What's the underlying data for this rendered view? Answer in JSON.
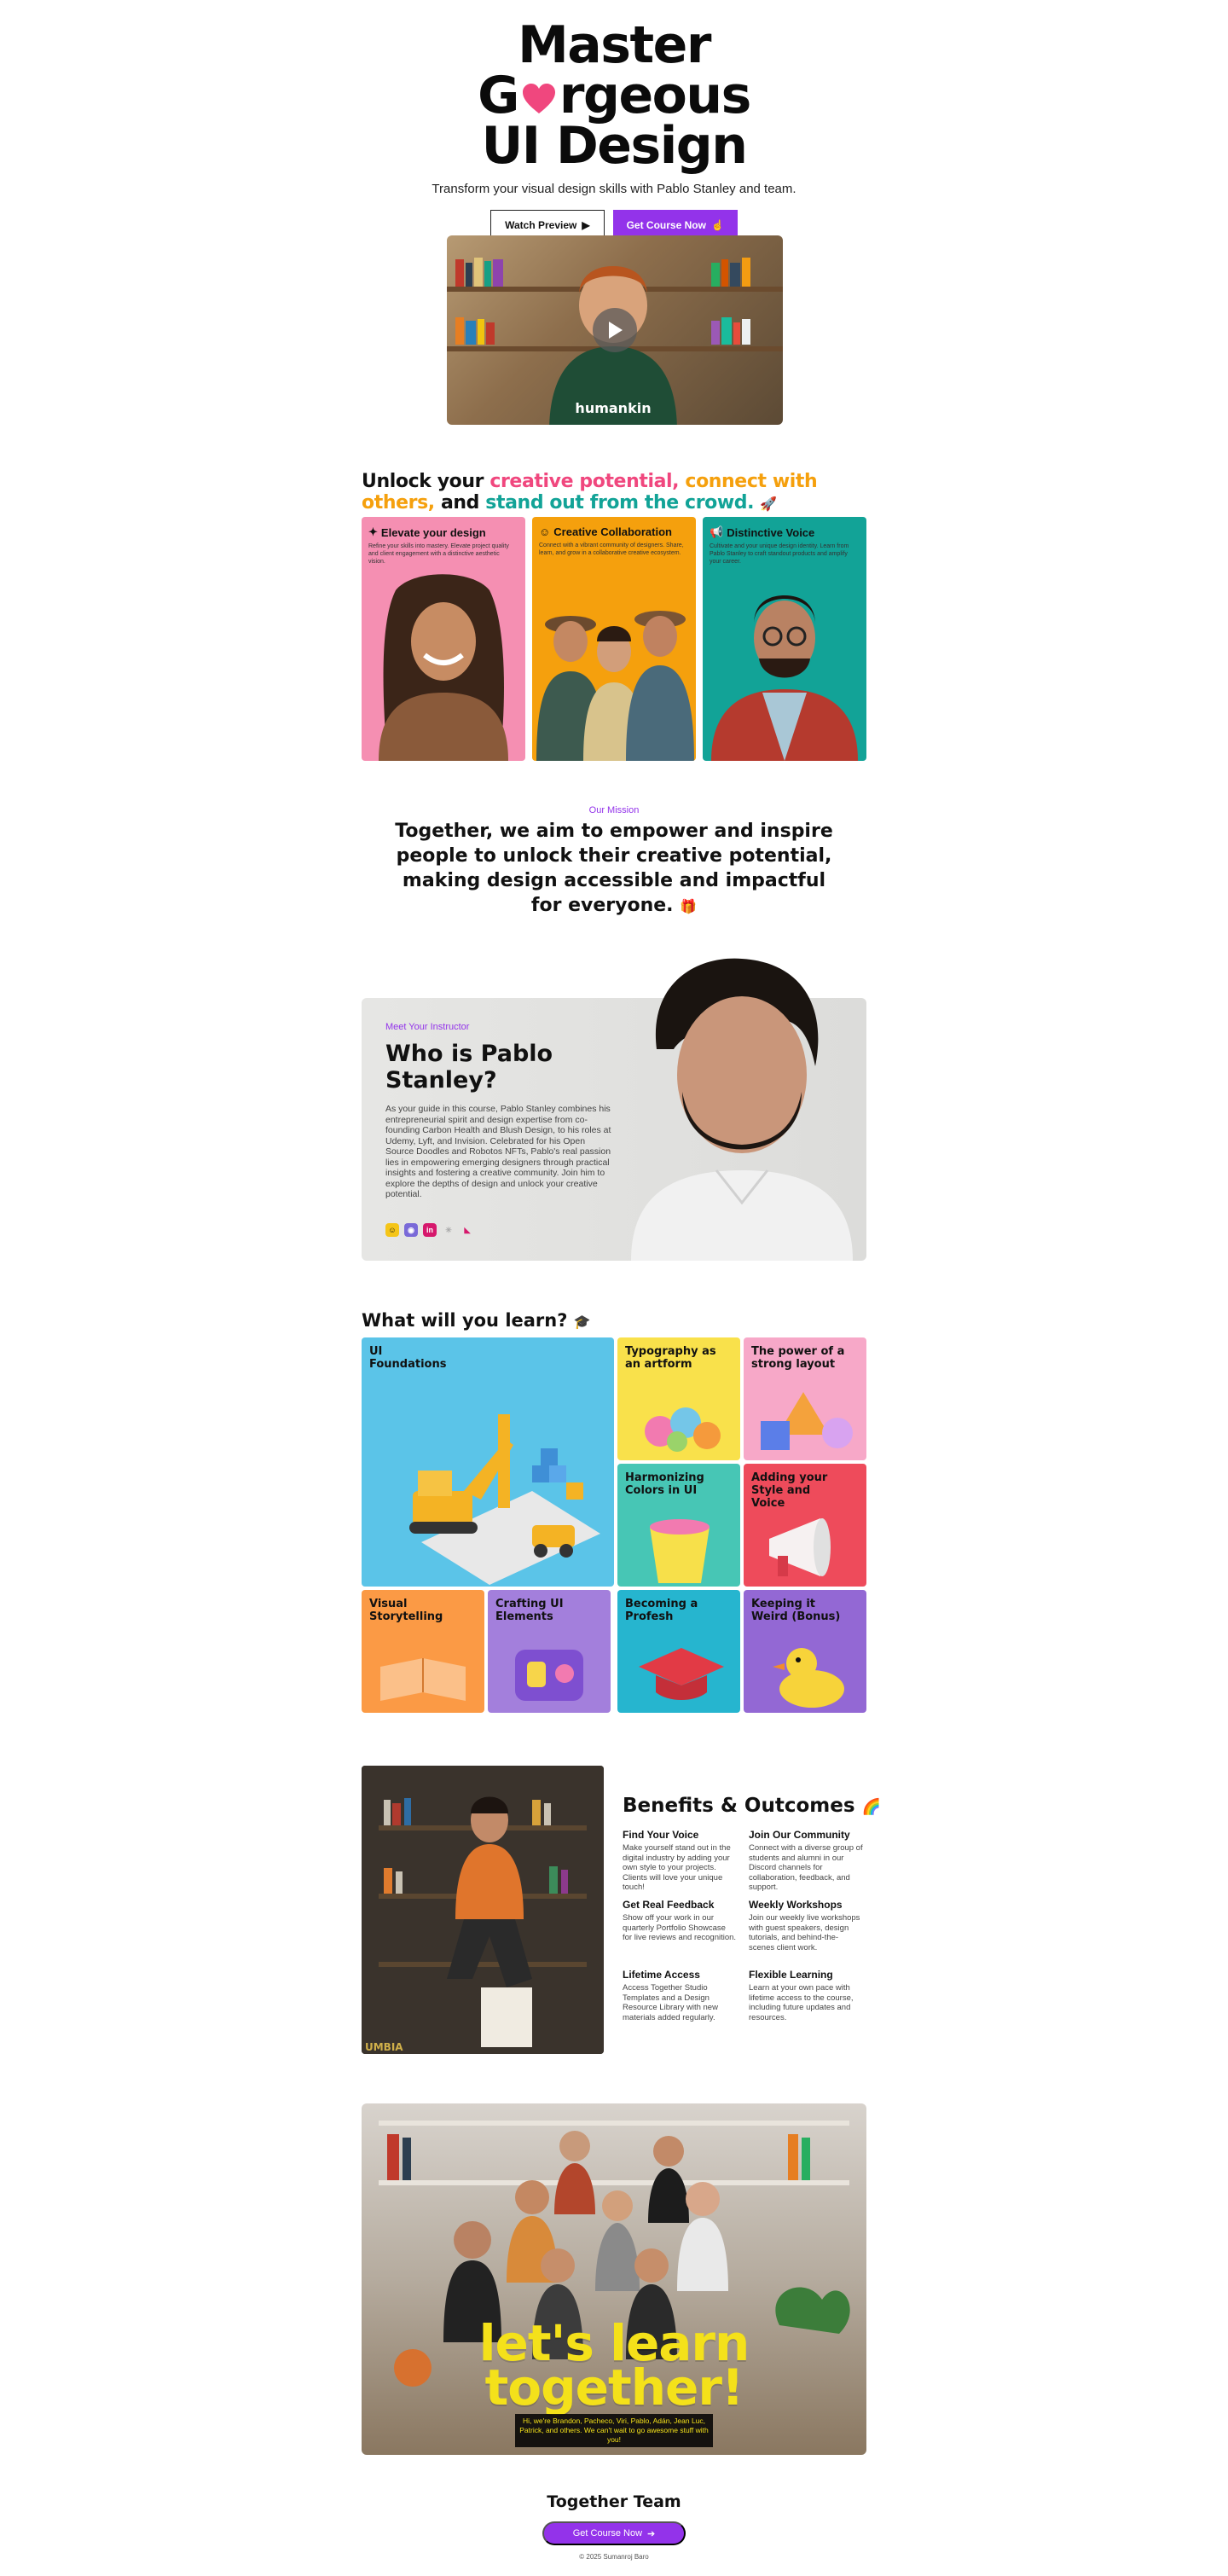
{
  "hero": {
    "title_line1": "Master",
    "title_line2_a": "G",
    "title_line2_b": "rgeous",
    "title_line3": "UI Design",
    "subtitle": "Transform your visual design skills with Pablo Stanley and team.",
    "watch_label": "Watch Preview",
    "cta_label": "Get Course Now",
    "heart_color": "#f0477e",
    "accent": "#9333ea"
  },
  "unlock": {
    "p1": "Unlock your ",
    "p2": "creative potential,",
    "p3": " ",
    "p4": "connect with others,",
    "p5": " and ",
    "p6": "stand out from the crowd.",
    "cards": [
      {
        "title": "Elevate your design",
        "icon": "sparkle-icon",
        "text": "Refine your skills into mastery. Elevate project quality and client engagement with a distinctive aesthetic vision.",
        "color": "#f58fb2"
      },
      {
        "title": "Creative Collaboration",
        "icon": "people-icon",
        "text": "Connect with a vibrant community of designers. Share, learn, and grow in a collaborative creative ecosystem.",
        "color": "#f5a00d"
      },
      {
        "title": "Distinctive Voice",
        "icon": "megaphone-icon",
        "text": "Cultivate and your unique design identity. Learn from Pablo Stanley to craft standout products and amplify your career.",
        "color": "#12a397"
      }
    ]
  },
  "mission": {
    "label": "Our Mission",
    "text": "Together, we aim to empower and inspire people to unlock their creative potential, making design accessible and impactful for everyone."
  },
  "instructor": {
    "label": "Meet Your Instructor",
    "title": "Who is Pablo Stanley?",
    "body": "As your guide in this course, Pablo Stanley combines his entrepreneurial spirit and design expertise from co-founding Carbon Health and Blush Design, to his roles at Udemy, Lyft, and Invision. Celebrated for his Open Source Doodles and Robotos NFTs, Pablo's real passion lies in empowering emerging designers through practical insights and fostering a creative community. Join him to explore the depths of design and unlock your creative potential.",
    "socials": [
      "smiley-icon",
      "robot-icon",
      "linkedin-icon",
      "sparkle-icon",
      "lemon-squeezy-icon"
    ]
  },
  "learn": {
    "title": "What will you learn?",
    "tiles": [
      {
        "label": "UI Foundations",
        "color": "#5bc4e8"
      },
      {
        "label": "Typography as an artform",
        "color": "#f9e14b"
      },
      {
        "label": "The power of a strong layout",
        "color": "#f7a8c8"
      },
      {
        "label": "Harmonizing Colors in UI",
        "color": "#47c6b5"
      },
      {
        "label": "Adding your Style and Voice",
        "color": "#ee4b5b"
      },
      {
        "label": "Visual Storytelling",
        "color": "#fb9a45"
      },
      {
        "label": "Crafting UI Elements",
        "color": "#a37fdc"
      },
      {
        "label": "Becoming a Profesh",
        "color": "#26b5cf"
      },
      {
        "label": "Keeping it Weird (Bonus)",
        "color": "#9368d4"
      }
    ]
  },
  "benefits": {
    "title": "Benefits & Outcomes",
    "items": [
      {
        "title": "Find Your Voice",
        "text": "Make yourself stand out in the digital industry by adding your own style to your projects. Clients will love your unique touch!"
      },
      {
        "title": "Join Our Community",
        "text": "Connect with a diverse group of students and alumni in our Discord channels for collaboration, feedback, and support."
      },
      {
        "title": "Get Real Feedback",
        "text": "Show off your work in our quarterly Portfolio Showcase for live reviews and recognition."
      },
      {
        "title": "Weekly Workshops",
        "text": "Join our weekly live workshops with guest speakers, design tutorials, and behind-the-scenes client work."
      },
      {
        "title": "Lifetime Access",
        "text": "Access Together Studio Templates and a Design Resource Library with new materials added regularly."
      },
      {
        "title": "Flexible Learning",
        "text": "Learn at your own pace with lifetime access to the course, including future updates and resources."
      }
    ]
  },
  "team": {
    "line1": "let's learn",
    "line2": "together!",
    "caption": "Hi, we're Brandon, Pacheco, Viri, Pablo, Adán, Jean Luc, Patrick, and others. We can't wait to go awesome stuff with you!",
    "footer_title": "Together Team",
    "footer_cta": "Get Course Now",
    "copyright": "© 2025 Sumanroj Baro"
  }
}
